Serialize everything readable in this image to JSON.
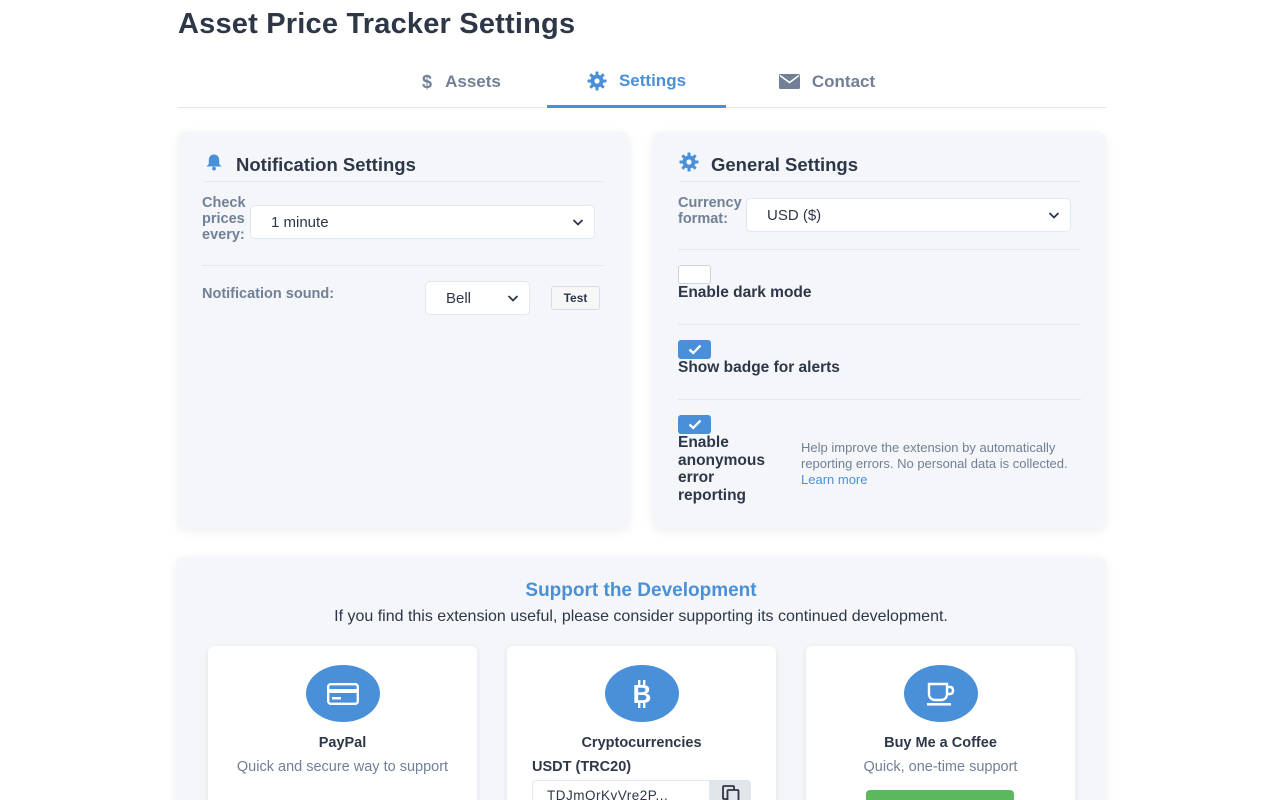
{
  "page": {
    "title": "Asset Price Tracker Settings"
  },
  "tabs": [
    {
      "label": "Assets",
      "icon": "dollar-icon",
      "active": false
    },
    {
      "label": "Settings",
      "icon": "gear-icon",
      "active": true
    },
    {
      "label": "Contact",
      "icon": "envelope-icon",
      "active": false
    }
  ],
  "notification": {
    "title": "Notification Settings",
    "icon": "bell-icon",
    "check_label": "Check prices every:",
    "check_label_lines": [
      "Check",
      "prices",
      "every:"
    ],
    "check_value": "1 minute",
    "sound_label": "Notification sound:",
    "sound_value": "Bell",
    "test_label": "Test"
  },
  "general": {
    "title": "General Settings",
    "icon": "gear-icon",
    "currency_label_lines": [
      "Currency",
      "format:"
    ],
    "currency_value": "USD ($)",
    "dark_mode": {
      "label": "Enable dark mode",
      "checked": false
    },
    "badge": {
      "label": "Show badge for alerts",
      "checked": true
    },
    "error_reporting": {
      "label_lines": [
        "Enable",
        "anonymous",
        "error",
        "reporting"
      ],
      "checked": true,
      "help_text": "Help improve the extension by automatically reporting errors. No personal data is collected.",
      "help_link": "Learn more"
    }
  },
  "support": {
    "title": "Support the Development",
    "subtitle": "If you find this extension useful, please consider supporting its continued development.",
    "cards": [
      {
        "title": "PayPal",
        "icon": "credit-card-icon",
        "description": "Quick and secure way to support"
      },
      {
        "title": "Cryptocurrencies",
        "icon": "bitcoin-icon",
        "network": "USDT (TRC20)",
        "address": "TDJmQrKyVre2P..."
      },
      {
        "title": "Buy Me a Coffee",
        "icon": "coffee-icon",
        "description": "Quick, one-time support"
      }
    ]
  },
  "colors": {
    "accent": "#4a90d9",
    "text": "#2d3748",
    "muted": "#718096",
    "card_bg": "#f4f6f9",
    "green": "#5cb85c"
  }
}
